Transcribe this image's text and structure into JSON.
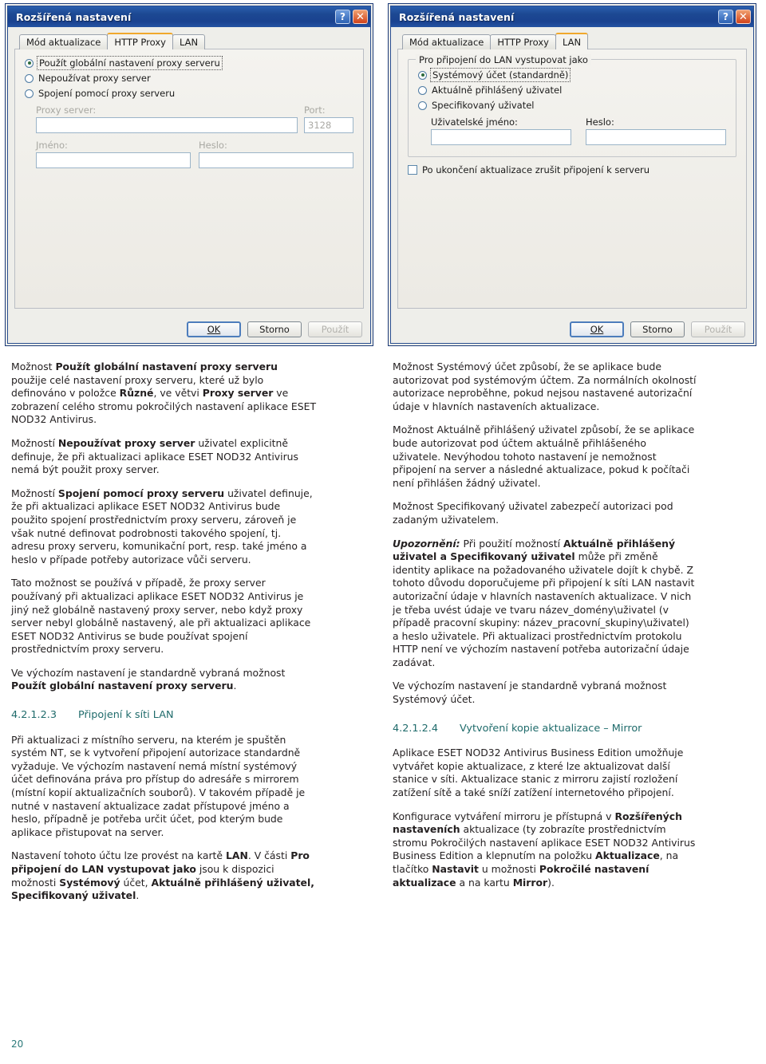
{
  "figures": {
    "left_dialog": {
      "title": "Rozšířená nastavení",
      "help_icon": "?",
      "close_icon": "✕",
      "tabs": [
        {
          "label": "Mód aktualizace",
          "active": false
        },
        {
          "label": "HTTP Proxy",
          "active": true
        },
        {
          "label": "LAN",
          "active": false
        }
      ],
      "radios": [
        {
          "label": "Použít globální nastavení proxy serveru",
          "checked": true,
          "focused": true
        },
        {
          "label": "Nepoužívat proxy server",
          "checked": false,
          "focused": false
        },
        {
          "label": "Spojení pomocí proxy serveru",
          "checked": false,
          "focused": false
        }
      ],
      "proxy_server_label": "Proxy server:",
      "proxy_server_value": "",
      "port_label": "Port:",
      "port_value": "3128",
      "name_label": "Jméno:",
      "name_value": "",
      "password_label": "Heslo:",
      "password_value": "",
      "buttons": [
        {
          "label": "OK",
          "style": "default"
        },
        {
          "label": "Storno",
          "style": "normal"
        },
        {
          "label": "Použít",
          "style": "disabled"
        }
      ]
    },
    "right_dialog": {
      "title": "Rozšířená nastavení",
      "help_icon": "?",
      "close_icon": "✕",
      "tabs": [
        {
          "label": "Mód aktualizace",
          "active": false
        },
        {
          "label": "HTTP Proxy",
          "active": false
        },
        {
          "label": "LAN",
          "active": true
        }
      ],
      "group_title": "Pro připojení do LAN vystupovat jako",
      "radios": [
        {
          "label": "Systémový účet (standardně)",
          "checked": true,
          "focused": true
        },
        {
          "label": "Aktuálně přihlášený uživatel",
          "checked": false,
          "focused": false
        },
        {
          "label": "Specifikovaný uživatel",
          "checked": false,
          "focused": false
        }
      ],
      "username_label": "Uživatelské jméno:",
      "username_value": "",
      "password_label": "Heslo:",
      "password_value": "",
      "checkbox_label": "Po ukončení aktualizace zrušit připojení k serveru",
      "checkbox_checked": false,
      "buttons": [
        {
          "label": "OK",
          "style": "default"
        },
        {
          "label": "Storno",
          "style": "normal"
        },
        {
          "label": "Použít",
          "style": "disabled"
        }
      ]
    }
  },
  "left_column": {
    "p1_a": "Možnost ",
    "p1_b1": "Použít globální nastavení proxy serveru",
    "p1_c": " použije celé nastavení proxy serveru, které už bylo definováno v položce ",
    "p1_b2": "Různé",
    "p1_d": ", ve větvi ",
    "p1_b3": "Proxy server",
    "p1_e": " ve zobrazení celého stromu pokročilých nastavení aplikace ESET NOD32 Antivirus.",
    "p2_a": "Možností ",
    "p2_b1": "Nepoužívat proxy server",
    "p2_c": " uživatel explicitně definuje, že při aktualizaci aplikace ESET NOD32 Antivirus nemá být použit proxy server.",
    "p3_a": "Možností ",
    "p3_b1": "Spojení pomocí proxy serveru",
    "p3_c": " uživatel definuje, že při aktualizaci aplikace ESET NOD32 Antivirus bude použito spojení prostřednictvím proxy serveru, zároveň je však nutné definovat podrobnosti takového spojení, tj. adresu proxy serveru, komunikační port, resp. také jméno a heslo v případe potřeby autorizace vůči serveru.",
    "p4": "Tato možnost se používá v případě, že proxy server používaný při aktualizaci aplikace ESET NOD32 Antivirus je jiný než globálně nastavený proxy server, nebo když proxy server nebyl globálně nastavený, ale při aktualizaci aplikace ESET NOD32 Antivirus se bude používat spojení prostřednictvím proxy serveru.",
    "p5_a": "Ve výchozím nastavení je standardně vybraná možnost ",
    "p5_b1": "Použít globální nastavení proxy serveru",
    "p5_c": ".",
    "heading_num": "4.2.1.2.3",
    "heading_title": "Připojení k síti LAN",
    "p6": "Při aktualizaci z místního serveru, na kterém je spuštěn systém NT, se k vytvoření připojení autorizace standardně vyžaduje. Ve výchozím nastavení nemá místní systémový účet definována práva pro přístup do adresáře s mirrorem (místní kopií aktualizačních souborů). V takovém případě je nutné v nastavení aktualizace zadat přístupové jméno a heslo, případně je potřeba určit účet, pod kterým bude aplikace přistupovat na server.",
    "p7_a": "Nastavení tohoto účtu lze provést na kartě ",
    "p7_b1": "LAN",
    "p7_c": ". V části ",
    "p7_b2": "Pro připojení do LAN vystupovat jako",
    "p7_d": " jsou k dispozici možnosti ",
    "p7_b3": "Systémový",
    "p7_e": " účet, ",
    "p7_b4": "Aktuálně přihlášený uživatel, Specifikovaný uživatel",
    "p7_f": "."
  },
  "right_column": {
    "p1": "Možnost Systémový účet způsobí, že se aplikace bude autorizovat pod systémovým účtem. Za normálních okolností autorizace neproběhne, pokud nejsou nastavené autorizační údaje v hlavních nastaveních aktualizace.",
    "p2": "Možnost Aktuálně přihlášený uživatel způsobí, že se aplikace bude autorizovat pod účtem aktuálně přihlášeného uživatele. Nevýhodou tohoto nastavení je nemožnost připojení na server a následné aktualizace, pokud k počítači není přihlášen žádný uživatel.",
    "p3": "Možnost Specifikovaný uživatel zabezpečí autorizaci pod zadaným uživatelem.",
    "p4_bi": "Upozornění:",
    "p4_a": " Při použití možností ",
    "p4_b1": "Aktuálně přihlášený uživatel a Specifikovaný uživatel",
    "p4_c": " může při změně identity aplikace na požadovaného uživatele dojít k chybě. Z tohoto důvodu doporučujeme při připojení k síti LAN nastavit autorizační údaje v hlavních nastaveních aktualizace. V nich je třeba uvést údaje ve tvaru název_domény\\uživatel (v případě pracovní skupiny: název_pracovní_skupiny\\uživatel) a heslo uživatele. Při aktualizaci prostřednictvím protokolu HTTP není ve výchozím nastavení potřeba autorizační údaje zadávat.",
    "p5": "Ve výchozím nastavení je standardně vybraná možnost Systémový účet.",
    "heading_num": "4.2.1.2.4",
    "heading_title": "Vytvoření kopie aktualizace – Mirror",
    "p6": "Aplikace ESET NOD32 Antivirus Business Edition umožňuje vytvářet kopie aktualizace, z které lze aktualizovat další stanice v síti. Aktualizace stanic z mirroru zajistí rozložení zatížení sítě a také sníží zatížení internetového připojení.",
    "p7_a": "Konfigurace vytváření mirroru je přístupná v ",
    "p7_b1": "Rozšířených nastaveních",
    "p7_c": " aktualizace (ty zobrazíte prostřednictvím stromu Pokročilých nastavení aplikace ESET NOD32 Antivirus Business Edition a klepnutím na položku ",
    "p7_b2": "Aktualizace",
    "p7_d": ", na tlačítko ",
    "p7_b3": "Nastavit",
    "p7_e": " u možnosti ",
    "p7_b4": "Pokročilé nastavení aktualizace",
    "p7_f": " a na kartu ",
    "p7_b5": "Mirror",
    "p7_g": ")."
  },
  "footer": {
    "page_number": "20"
  }
}
